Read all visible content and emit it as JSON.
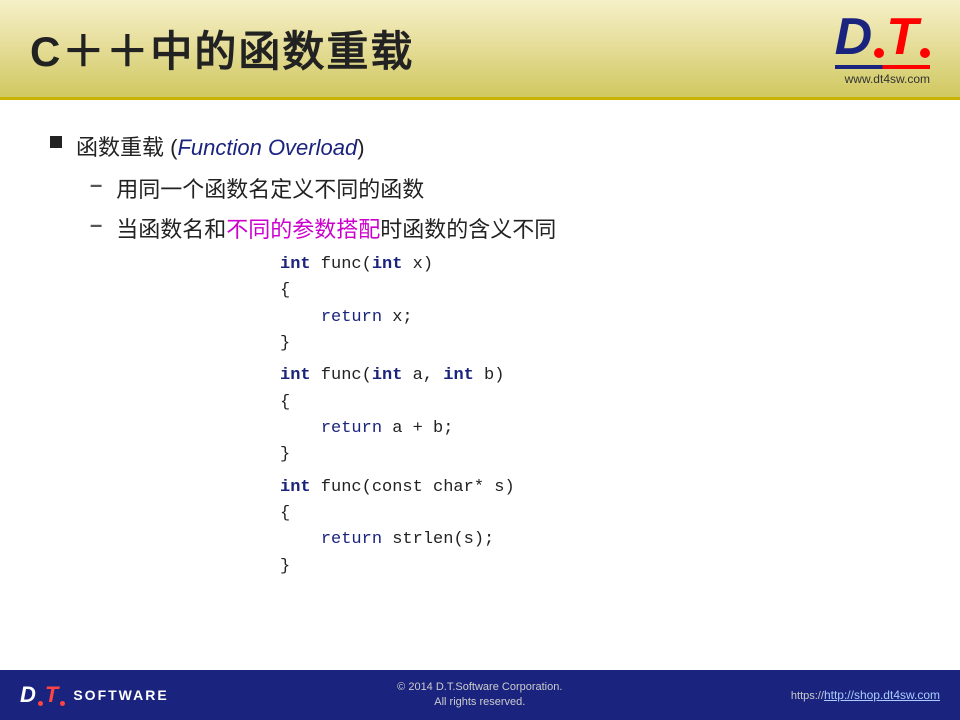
{
  "header": {
    "title": "C＋＋中的函数重载",
    "logo_d": "D",
    "logo_t": "T",
    "logo_url": "www.dt4sw.com"
  },
  "content": {
    "bullet1": {
      "prefix": "函数重载 (",
      "highlight": "Function Overload",
      "suffix": ")"
    },
    "sub1": {
      "text_red": "用同一个函数名定义不同的函数"
    },
    "sub2": {
      "text_before": "当函数名和",
      "text_magenta": "不同的参数搭配",
      "text_after": "时函数的含义不同"
    },
    "code1": {
      "line1": "int func(int x)",
      "line2": "{",
      "line3": "    return x;",
      "line4": "}"
    },
    "code2": {
      "line1": "int func(int a, int b)",
      "line2": "{",
      "line3": "    return a + b;",
      "line4": "}"
    },
    "code3": {
      "line1": "int func(const char* s)",
      "line2": "{",
      "line3": "    return strlen(s);",
      "line4": "}"
    }
  },
  "footer": {
    "logo_d": "D",
    "logo_t": "T",
    "software_label": "SOFTWARE",
    "copyright_line1": "© 2014 D.T.Software Corporation.",
    "copyright_line2": "All rights reserved.",
    "link_prefix": "https://",
    "link_text": "http://shop.dt4sw.com"
  }
}
